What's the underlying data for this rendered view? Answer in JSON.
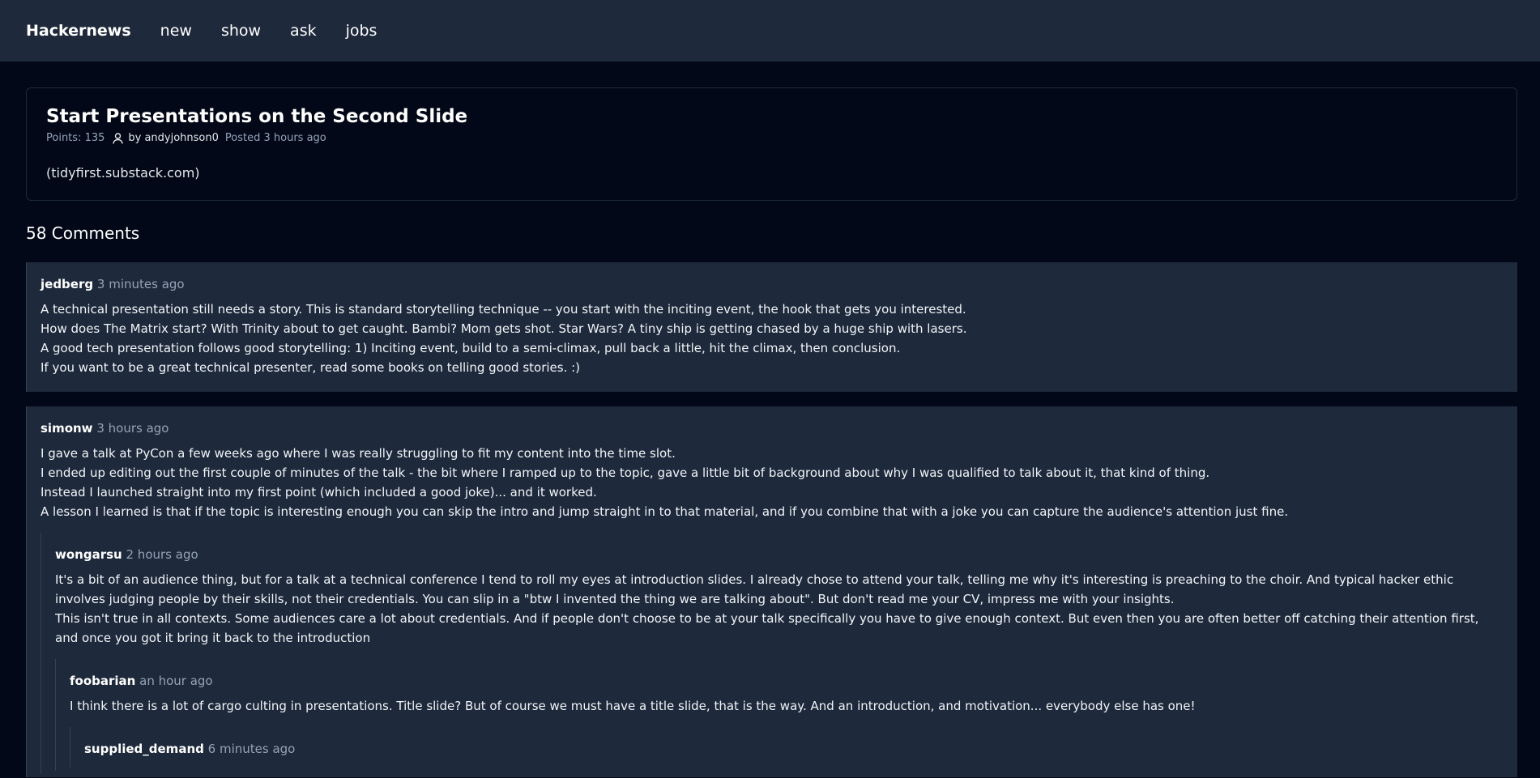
{
  "nav": {
    "brand": "Hackernews",
    "links": [
      "new",
      "show",
      "ask",
      "jobs"
    ]
  },
  "story": {
    "title": "Start Presentations on the Second Slide",
    "points": "Points: 135",
    "author": "by andyjohnson0",
    "posted": "Posted 3 hours ago",
    "domain": "(tidyfirst.substack.com)"
  },
  "comments_title": "58 Comments",
  "comments": [
    {
      "author": "jedberg",
      "time": "3 minutes ago",
      "lines": [
        "A technical presentation still needs a story. This is standard storytelling technique -- you start with the inciting event, the hook that gets you interested.",
        "How does The Matrix start? With Trinity about to get caught. Bambi? Mom gets shot. Star Wars? A tiny ship is getting chased by a huge ship with lasers.",
        "A good tech presentation follows good storytelling: 1) Inciting event, build to a semi-climax, pull back a little, hit the climax, then conclusion.",
        "If you want to be a great technical presenter, read some books on telling good stories. :)"
      ]
    },
    {
      "author": "simonw",
      "time": "3 hours ago",
      "lines": [
        "I gave a talk at PyCon a few weeks ago where I was really struggling to fit my content into the time slot.",
        "I ended up editing out the first couple of minutes of the talk - the bit where I ramped up to the topic, gave a little bit of background about why I was qualified to talk about it, that kind of thing.",
        "Instead I launched straight into my first point (which included a good joke)... and it worked.",
        "A lesson I learned is that if the topic is interesting enough you can skip the intro and jump straight in to that material, and if you combine that with a joke you can capture the audience's attention just fine."
      ],
      "reply": {
        "author": "wongarsu",
        "time": "2 hours ago",
        "lines": [
          "It's a bit of an audience thing, but for a talk at a technical conference I tend to roll my eyes at introduction slides. I already chose to attend your talk, telling me why it's interesting is preaching to the choir. And typical hacker ethic involves judging people by their skills, not their credentials. You can slip in a \"btw I invented the thing we are talking about\". But don't read me your CV, impress me with your insights.",
          "This isn't true in all contexts. Some audiences care a lot about credentials. And if people don't choose to be at your talk specifically you have to give enough context. But even then you are often better off catching their attention first, and once you got it bring it back to the introduction"
        ],
        "reply": {
          "author": "foobarian",
          "time": "an hour ago",
          "lines": [
            "I think there is a lot of cargo culting in presentations. Title slide? But of course we must have a title slide, that is the way. And an introduction, and motivation... everybody else has one!"
          ],
          "reply": {
            "author": "supplied_demand",
            "time": "6 minutes ago"
          }
        }
      }
    }
  ]
}
